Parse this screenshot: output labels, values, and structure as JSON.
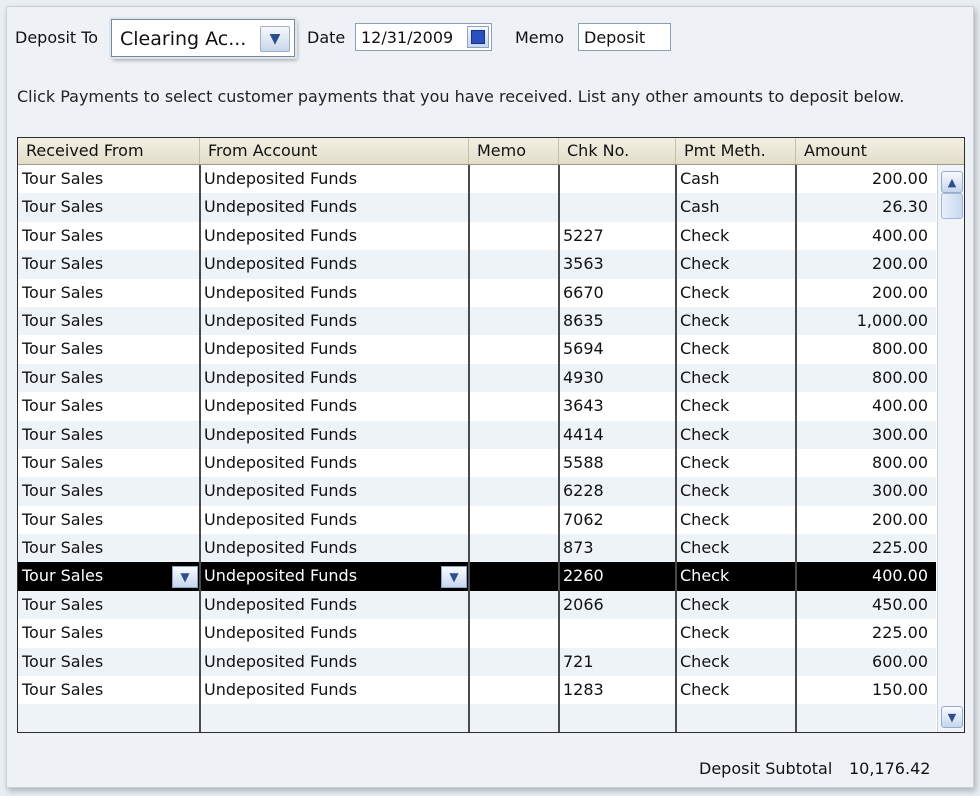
{
  "header": {
    "deposit_to_label": "Deposit To",
    "deposit_to_value": "Clearing Ac...",
    "date_label": "Date",
    "date_value": "12/31/2009",
    "memo_label": "Memo",
    "memo_value": "Deposit"
  },
  "instruction": "Click Payments to select customer payments that you have received. List any other amounts to deposit below.",
  "table": {
    "columns": [
      "Received From",
      "From Account",
      "Memo",
      "Chk No.",
      "Pmt Meth.",
      "Amount"
    ],
    "rows": [
      {
        "received_from": "Tour Sales",
        "from_account": "Undeposited Funds",
        "memo": "",
        "chk_no": "",
        "pmt_meth": "Cash",
        "amount": "200.00"
      },
      {
        "received_from": "Tour Sales",
        "from_account": "Undeposited Funds",
        "memo": "",
        "chk_no": "",
        "pmt_meth": "Cash",
        "amount": "26.30"
      },
      {
        "received_from": "Tour Sales",
        "from_account": "Undeposited Funds",
        "memo": "",
        "chk_no": "5227",
        "pmt_meth": "Check",
        "amount": "400.00"
      },
      {
        "received_from": "Tour Sales",
        "from_account": "Undeposited Funds",
        "memo": "",
        "chk_no": "3563",
        "pmt_meth": "Check",
        "amount": "200.00"
      },
      {
        "received_from": "Tour Sales",
        "from_account": "Undeposited Funds",
        "memo": "",
        "chk_no": "6670",
        "pmt_meth": "Check",
        "amount": "200.00"
      },
      {
        "received_from": "Tour Sales",
        "from_account": "Undeposited Funds",
        "memo": "",
        "chk_no": "8635",
        "pmt_meth": "Check",
        "amount": "1,000.00"
      },
      {
        "received_from": "Tour Sales",
        "from_account": "Undeposited Funds",
        "memo": "",
        "chk_no": "5694",
        "pmt_meth": "Check",
        "amount": "800.00"
      },
      {
        "received_from": "Tour Sales",
        "from_account": "Undeposited Funds",
        "memo": "",
        "chk_no": "4930",
        "pmt_meth": "Check",
        "amount": "800.00"
      },
      {
        "received_from": "Tour Sales",
        "from_account": "Undeposited Funds",
        "memo": "",
        "chk_no": "3643",
        "pmt_meth": "Check",
        "amount": "400.00"
      },
      {
        "received_from": "Tour Sales",
        "from_account": "Undeposited Funds",
        "memo": "",
        "chk_no": "4414",
        "pmt_meth": "Check",
        "amount": "300.00"
      },
      {
        "received_from": "Tour Sales",
        "from_account": "Undeposited Funds",
        "memo": "",
        "chk_no": "5588",
        "pmt_meth": "Check",
        "amount": "800.00"
      },
      {
        "received_from": "Tour Sales",
        "from_account": "Undeposited Funds",
        "memo": "",
        "chk_no": "6228",
        "pmt_meth": "Check",
        "amount": "300.00"
      },
      {
        "received_from": "Tour Sales",
        "from_account": "Undeposited Funds",
        "memo": "",
        "chk_no": "7062",
        "pmt_meth": "Check",
        "amount": "200.00"
      },
      {
        "received_from": "Tour Sales",
        "from_account": "Undeposited Funds",
        "memo": "",
        "chk_no": "873",
        "pmt_meth": "Check",
        "amount": "225.00"
      },
      {
        "received_from": "Tour Sales",
        "from_account": "Undeposited Funds",
        "memo": "",
        "chk_no": "2260",
        "pmt_meth": "Check",
        "amount": "400.00",
        "selected": true
      },
      {
        "received_from": "Tour Sales",
        "from_account": "Undeposited Funds",
        "memo": "",
        "chk_no": "2066",
        "pmt_meth": "Check",
        "amount": "450.00"
      },
      {
        "received_from": "Tour Sales",
        "from_account": "Undeposited Funds",
        "memo": "",
        "chk_no": "",
        "pmt_meth": "Check",
        "amount": "225.00"
      },
      {
        "received_from": "Tour Sales",
        "from_account": "Undeposited Funds",
        "memo": "",
        "chk_no": "721",
        "pmt_meth": "Check",
        "amount": "600.00"
      },
      {
        "received_from": "Tour Sales",
        "from_account": "Undeposited Funds",
        "memo": "",
        "chk_no": "1283",
        "pmt_meth": "Check",
        "amount": "150.00"
      },
      {
        "received_from": "",
        "from_account": "",
        "memo": "",
        "chk_no": "",
        "pmt_meth": "",
        "amount": ""
      }
    ]
  },
  "footer": {
    "subtotal_label": "Deposit Subtotal",
    "subtotal_value": "10,176.42"
  },
  "icons": {
    "dropdown": "chevron-down-icon",
    "calendar": "calendar-icon",
    "scroll_up": "scroll-up-icon",
    "scroll_down": "scroll-down-icon"
  },
  "colors": {
    "selected_row_bg": "#000000",
    "selected_row_fg": "#ffffff",
    "alt_row_bg": "#eef3f8",
    "header_bg": "#e2ddc9"
  }
}
